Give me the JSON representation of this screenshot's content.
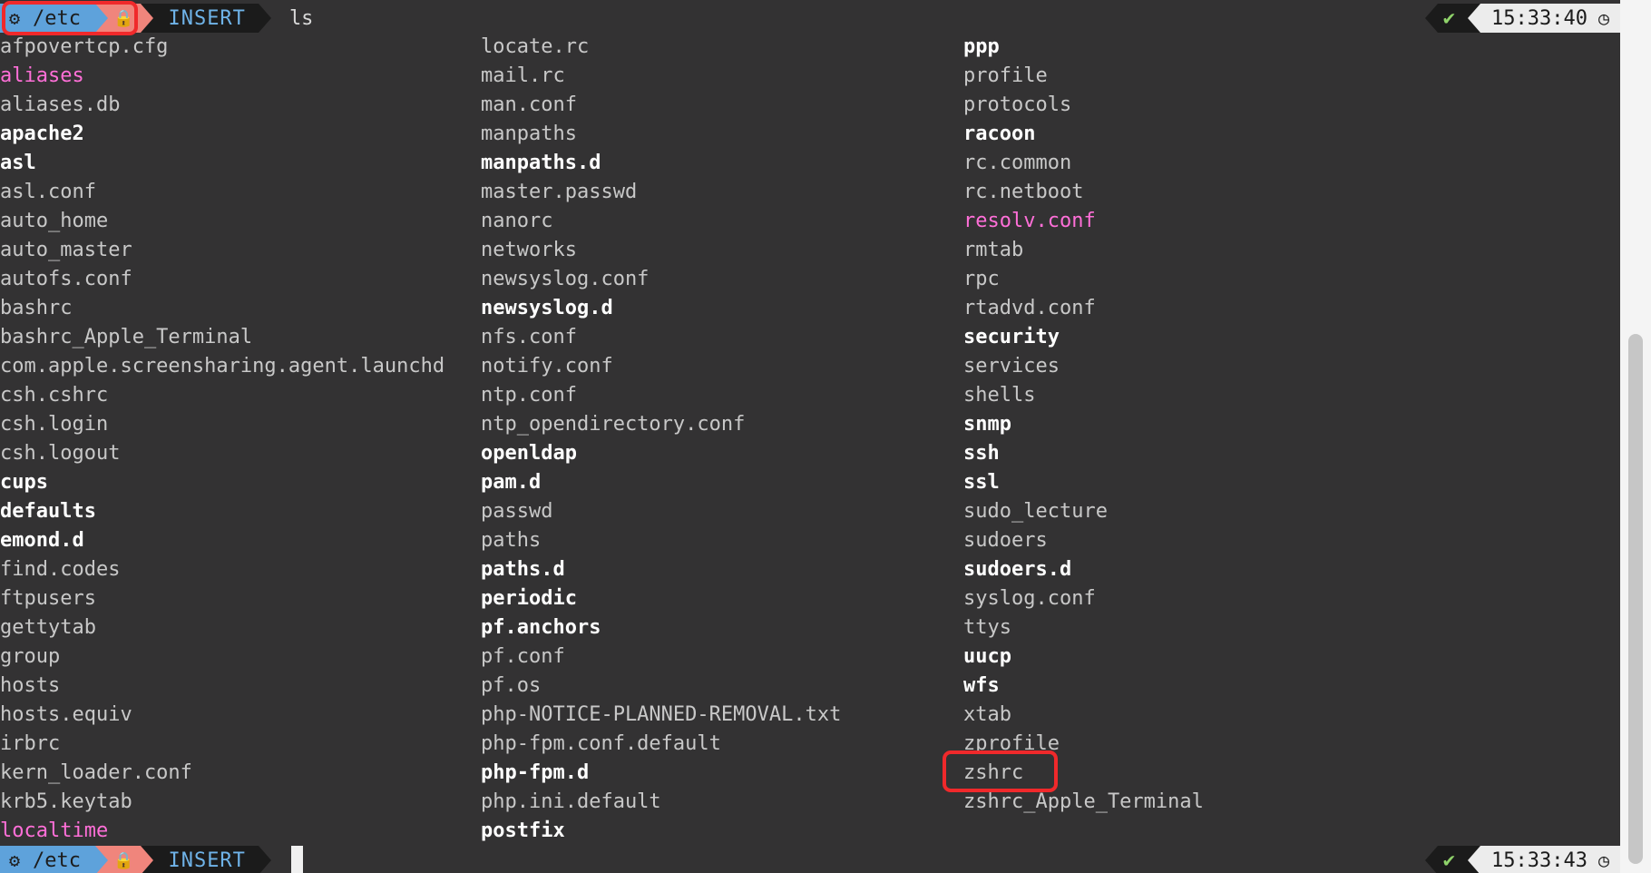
{
  "prompt_top": {
    "gear_icon": "gear-icon",
    "directory": "/etc",
    "lock_icon": "lock-icon",
    "mode": "INSERT",
    "command": "ls",
    "status_icon": "checkmark-icon",
    "status_mark": "✔",
    "time": "15:33:40",
    "clock_icon": "clock-icon"
  },
  "prompt_bottom": {
    "gear_icon": "gear-icon",
    "directory": "/etc",
    "lock_icon": "lock-icon",
    "mode": "INSERT",
    "status_icon": "checkmark-icon",
    "status_mark": "✔",
    "time": "15:33:43",
    "clock_icon": "clock-icon"
  },
  "colors": {
    "background": "#333233",
    "directory_segment": "#5ea2db",
    "lock_segment": "#f0857c",
    "symlink_text": "#ff6fd8",
    "highlight_box": "#f0292b",
    "status_ok": "#8fd36a"
  },
  "listing": {
    "column1": [
      {
        "name": "afpovertcp.cfg",
        "kind": "file"
      },
      {
        "name": "aliases",
        "kind": "link"
      },
      {
        "name": "aliases.db",
        "kind": "file"
      },
      {
        "name": "apache2",
        "kind": "dir"
      },
      {
        "name": "asl",
        "kind": "dir"
      },
      {
        "name": "asl.conf",
        "kind": "file"
      },
      {
        "name": "auto_home",
        "kind": "file"
      },
      {
        "name": "auto_master",
        "kind": "file"
      },
      {
        "name": "autofs.conf",
        "kind": "file"
      },
      {
        "name": "bashrc",
        "kind": "file"
      },
      {
        "name": "bashrc_Apple_Terminal",
        "kind": "file"
      },
      {
        "name": "com.apple.screensharing.agent.launchd",
        "kind": "file"
      },
      {
        "name": "csh.cshrc",
        "kind": "file"
      },
      {
        "name": "csh.login",
        "kind": "file"
      },
      {
        "name": "csh.logout",
        "kind": "file"
      },
      {
        "name": "cups",
        "kind": "dir"
      },
      {
        "name": "defaults",
        "kind": "dir"
      },
      {
        "name": "emond.d",
        "kind": "dir"
      },
      {
        "name": "find.codes",
        "kind": "file"
      },
      {
        "name": "ftpusers",
        "kind": "file"
      },
      {
        "name": "gettytab",
        "kind": "file"
      },
      {
        "name": "group",
        "kind": "file"
      },
      {
        "name": "hosts",
        "kind": "file"
      },
      {
        "name": "hosts.equiv",
        "kind": "file"
      },
      {
        "name": "irbrc",
        "kind": "file"
      },
      {
        "name": "kern_loader.conf",
        "kind": "file"
      },
      {
        "name": "krb5.keytab",
        "kind": "file"
      },
      {
        "name": "localtime",
        "kind": "link"
      }
    ],
    "column2": [
      {
        "name": "locate.rc",
        "kind": "file"
      },
      {
        "name": "mail.rc",
        "kind": "file"
      },
      {
        "name": "man.conf",
        "kind": "file"
      },
      {
        "name": "manpaths",
        "kind": "file"
      },
      {
        "name": "manpaths.d",
        "kind": "dir"
      },
      {
        "name": "master.passwd",
        "kind": "file"
      },
      {
        "name": "nanorc",
        "kind": "file"
      },
      {
        "name": "networks",
        "kind": "file"
      },
      {
        "name": "newsyslog.conf",
        "kind": "file"
      },
      {
        "name": "newsyslog.d",
        "kind": "dir"
      },
      {
        "name": "nfs.conf",
        "kind": "file"
      },
      {
        "name": "notify.conf",
        "kind": "file"
      },
      {
        "name": "ntp.conf",
        "kind": "file"
      },
      {
        "name": "ntp_opendirectory.conf",
        "kind": "file"
      },
      {
        "name": "openldap",
        "kind": "dir"
      },
      {
        "name": "pam.d",
        "kind": "dir"
      },
      {
        "name": "passwd",
        "kind": "file"
      },
      {
        "name": "paths",
        "kind": "file"
      },
      {
        "name": "paths.d",
        "kind": "dir"
      },
      {
        "name": "periodic",
        "kind": "dir"
      },
      {
        "name": "pf.anchors",
        "kind": "dir"
      },
      {
        "name": "pf.conf",
        "kind": "file"
      },
      {
        "name": "pf.os",
        "kind": "file"
      },
      {
        "name": "php-NOTICE-PLANNED-REMOVAL.txt",
        "kind": "file"
      },
      {
        "name": "php-fpm.conf.default",
        "kind": "file"
      },
      {
        "name": "php-fpm.d",
        "kind": "dir"
      },
      {
        "name": "php.ini.default",
        "kind": "file"
      },
      {
        "name": "postfix",
        "kind": "dir"
      }
    ],
    "column3": [
      {
        "name": "ppp",
        "kind": "dir"
      },
      {
        "name": "profile",
        "kind": "file"
      },
      {
        "name": "protocols",
        "kind": "file"
      },
      {
        "name": "racoon",
        "kind": "dir"
      },
      {
        "name": "rc.common",
        "kind": "file"
      },
      {
        "name": "rc.netboot",
        "kind": "file"
      },
      {
        "name": "resolv.conf",
        "kind": "link"
      },
      {
        "name": "rmtab",
        "kind": "file"
      },
      {
        "name": "rpc",
        "kind": "file"
      },
      {
        "name": "rtadvd.conf",
        "kind": "file"
      },
      {
        "name": "security",
        "kind": "dir"
      },
      {
        "name": "services",
        "kind": "file"
      },
      {
        "name": "shells",
        "kind": "file"
      },
      {
        "name": "snmp",
        "kind": "dir"
      },
      {
        "name": "ssh",
        "kind": "dir"
      },
      {
        "name": "ssl",
        "kind": "dir"
      },
      {
        "name": "sudo_lecture",
        "kind": "file"
      },
      {
        "name": "sudoers",
        "kind": "file"
      },
      {
        "name": "sudoers.d",
        "kind": "dir"
      },
      {
        "name": "syslog.conf",
        "kind": "file"
      },
      {
        "name": "ttys",
        "kind": "file"
      },
      {
        "name": "uucp",
        "kind": "dir"
      },
      {
        "name": "wfs",
        "kind": "dir"
      },
      {
        "name": "xtab",
        "kind": "file"
      },
      {
        "name": "zprofile",
        "kind": "file"
      },
      {
        "name": "zshrc",
        "kind": "file"
      },
      {
        "name": "zshrc_Apple_Terminal",
        "kind": "file"
      }
    ]
  },
  "highlighted": [
    "/etc",
    "zshrc"
  ]
}
